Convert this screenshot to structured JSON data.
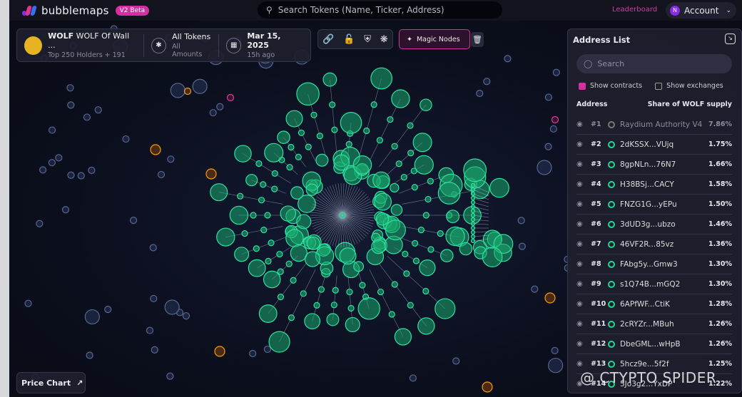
{
  "header": {
    "brand": "bubblemaps",
    "badge": "V2 Beta",
    "search_placeholder": "Search Tokens (Name, Ticker, Address)",
    "leaderboard": "Leaderboard",
    "account": "Account",
    "account_initial": "N"
  },
  "token": {
    "ticker": "WOLF",
    "name": "WOLF Of Wall ...",
    "holders": "Top 250 Holders + 191",
    "filter_title": "All Tokens",
    "filter_sub": "All Amounts",
    "date": "Mar 15, 2025",
    "ago": "15h ago"
  },
  "toolbar": {
    "magic_nodes": "Magic Nodes",
    "icons": [
      "link-icon",
      "lock-icon",
      "shield-icon",
      "network-icon"
    ]
  },
  "address_list": {
    "title": "Address List",
    "search_placeholder": "Search",
    "show_contracts": "Show contracts",
    "show_contracts_checked": true,
    "show_exchanges": "Show exchanges",
    "show_exchanges_checked": false,
    "col_address": "Address",
    "col_share": "Share of WOLF supply",
    "rows": [
      {
        "rank": "#1",
        "address": "Raydium Authority V4",
        "share": "7.86%",
        "hidden": true
      },
      {
        "rank": "#2",
        "address": "2dKSSX...VUjq",
        "share": "1.75%"
      },
      {
        "rank": "#3",
        "address": "8gpNLn...76N7",
        "share": "1.66%"
      },
      {
        "rank": "#4",
        "address": "H38BSj...CACY",
        "share": "1.58%"
      },
      {
        "rank": "#5",
        "address": "FNZG1G...yEPu",
        "share": "1.50%"
      },
      {
        "rank": "#6",
        "address": "3dUD3g...ubzo",
        "share": "1.46%"
      },
      {
        "rank": "#7",
        "address": "46VF2R...85vz",
        "share": "1.36%"
      },
      {
        "rank": "#8",
        "address": "FAbg5y...Gmw3",
        "share": "1.30%"
      },
      {
        "rank": "#9",
        "address": "s1Q74B...mGQ2",
        "share": "1.30%"
      },
      {
        "rank": "#10",
        "address": "6APfWF...CtiK",
        "share": "1.28%"
      },
      {
        "rank": "#11",
        "address": "2cRYZr...MBuh",
        "share": "1.26%"
      },
      {
        "rank": "#12",
        "address": "DbeGML...wHpB",
        "share": "1.26%"
      },
      {
        "rank": "#13",
        "address": "5hcz9e...5f2f",
        "share": "1.25%"
      },
      {
        "rank": "#14",
        "address": "5Jo3g2...YxDP",
        "share": "1.22%"
      }
    ]
  },
  "price_chart": "Price Chart",
  "watermark": "@ CTYPTO SPIDER",
  "colors": {
    "accent": "#d62ea0",
    "holder": "#1fd88f",
    "background_node": "#5a6a90",
    "exchange": "#f39c12"
  }
}
